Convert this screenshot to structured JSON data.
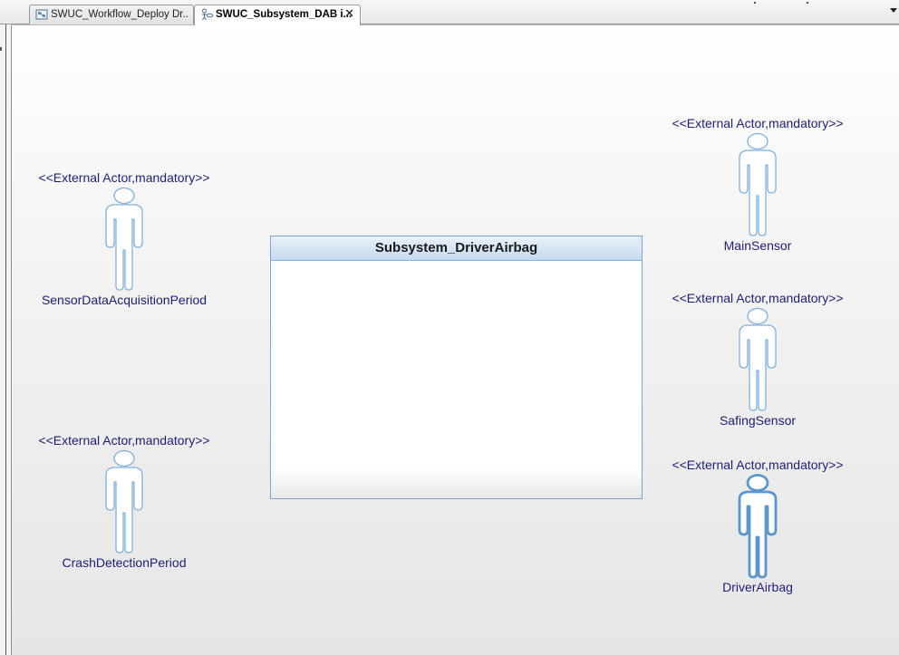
{
  "tabs": [
    {
      "label": "SWUC_Workflow_Deploy Dr..",
      "icon": "workflow-diagram-icon",
      "active": false
    },
    {
      "label": "SWUC_Subsystem_DAB i...",
      "icon": "use-case-diagram-icon",
      "active": true,
      "close_label": "✕"
    }
  ],
  "diagram": {
    "subsystem": {
      "title": "Subsystem_DriverAirbag"
    },
    "actors": [
      {
        "stereotype": "<<External Actor,mandatory>>",
        "name": "SensorDataAcquisitionPeriod"
      },
      {
        "stereotype": "<<External Actor,mandatory>>",
        "name": "CrashDetectionPeriod"
      },
      {
        "stereotype": "<<External Actor,mandatory>>",
        "name": "MainSensor"
      },
      {
        "stereotype": "<<External Actor,mandatory>>",
        "name": "SafingSensor"
      },
      {
        "stereotype": "<<External Actor,mandatory>>",
        "name": "DriverAirbag",
        "selected": true
      }
    ]
  },
  "colors": {
    "actor_text": "#1d1d7a",
    "actor_outline": "#7fb0dc",
    "actor_selected_outline": "#5b97cc",
    "subsystem_border": "#7ba5d0",
    "subsystem_header": "#c7daef"
  }
}
